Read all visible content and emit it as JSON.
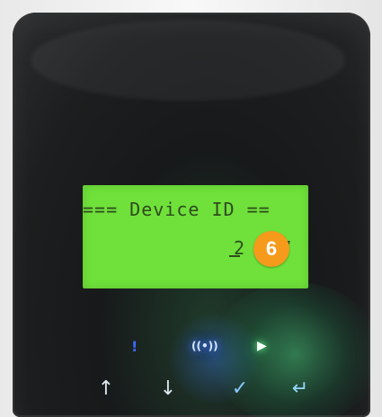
{
  "display": {
    "title_line": "=== Device ID ==",
    "device_id_line": "2 4 7"
  },
  "annotation": {
    "badge_number": "6"
  },
  "indicators": {
    "info": "!",
    "network": "((•))",
    "play": "▶"
  },
  "keys": {
    "up": "↑",
    "down": "↓",
    "confirm": "✓",
    "enter": "↵"
  },
  "colors": {
    "lcd_green": "#6fe13a",
    "badge_orange": "#f59a1b",
    "led_blue": "#3b69ff",
    "led_green": "#72ff96"
  },
  "icons": {
    "up_key": "up-arrow-icon",
    "down_key": "down-arrow-icon",
    "confirm_key": "check-icon",
    "enter_key": "enter-icon",
    "info_led": "info-icon",
    "network_led": "wireless-icon",
    "play_led": "play-icon"
  }
}
